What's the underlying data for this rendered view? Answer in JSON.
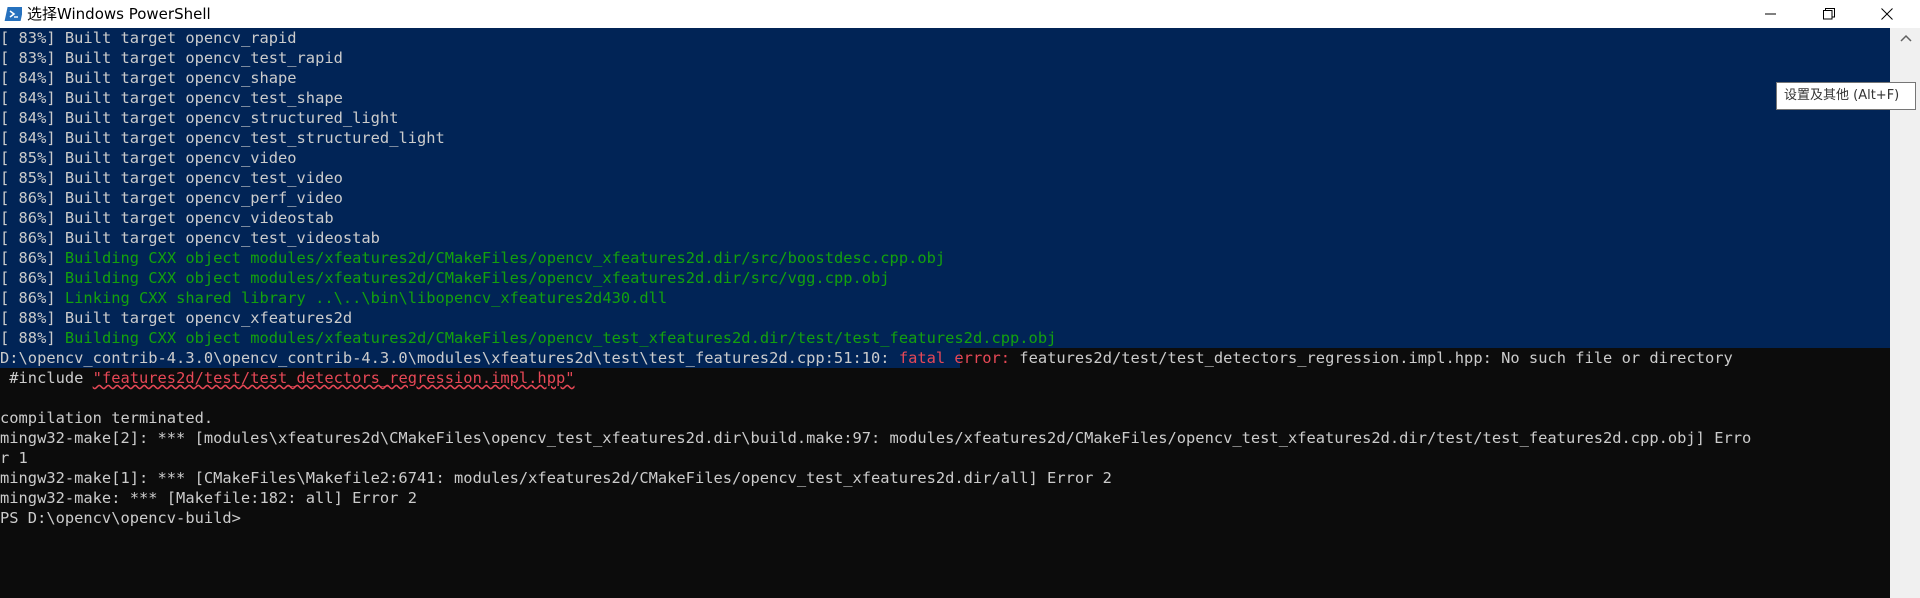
{
  "window": {
    "title": "选择Windows PowerShell",
    "tooltip": "设置及其他 (Alt+F)"
  },
  "terminal": {
    "build_lines": [
      {
        "pct": "[ 83%]",
        "msg": "Built target opencv_rapid",
        "color": "default"
      },
      {
        "pct": "[ 83%]",
        "msg": "Built target opencv_test_rapid",
        "color": "default"
      },
      {
        "pct": "[ 84%]",
        "msg": "Built target opencv_shape",
        "color": "default"
      },
      {
        "pct": "[ 84%]",
        "msg": "Built target opencv_test_shape",
        "color": "default"
      },
      {
        "pct": "[ 84%]",
        "msg": "Built target opencv_structured_light",
        "color": "default"
      },
      {
        "pct": "[ 84%]",
        "msg": "Built target opencv_test_structured_light",
        "color": "default"
      },
      {
        "pct": "[ 85%]",
        "msg": "Built target opencv_video",
        "color": "default"
      },
      {
        "pct": "[ 85%]",
        "msg": "Built target opencv_test_video",
        "color": "default"
      },
      {
        "pct": "[ 86%]",
        "msg": "Built target opencv_perf_video",
        "color": "default"
      },
      {
        "pct": "[ 86%]",
        "msg": "Built target opencv_videostab",
        "color": "default"
      },
      {
        "pct": "[ 86%]",
        "msg": "Built target opencv_test_videostab",
        "color": "default"
      },
      {
        "pct": "[ 86%]",
        "msg": "Building CXX object modules/xfeatures2d/CMakeFiles/opencv_xfeatures2d.dir/src/boostdesc.cpp.obj",
        "color": "green"
      },
      {
        "pct": "[ 86%]",
        "msg": "Building CXX object modules/xfeatures2d/CMakeFiles/opencv_xfeatures2d.dir/src/vgg.cpp.obj",
        "color": "green"
      },
      {
        "pct": "[ 86%]",
        "msg": "Linking CXX shared library ..\\..\\bin\\libopencv_xfeatures2d430.dll",
        "color": "green"
      },
      {
        "pct": "[ 88%]",
        "msg": "Built target opencv_xfeatures2d",
        "color": "default"
      },
      {
        "pct": "[ 88%]",
        "msg": "Building CXX object modules/xfeatures2d/CMakeFiles/opencv_test_xfeatures2d.dir/test/test_features2d.cpp.obj",
        "color": "green"
      }
    ],
    "error_path": "D:\\opencv_contrib-4.3.0\\opencv_contrib-4.3.0\\modules\\xfeatures2d\\test\\test_features2d.cpp:51:10:",
    "error_label": "fatal error:",
    "error_msg": "features2d/test/test_detectors_regression.impl.hpp: No such file or directory",
    "include_prefix": " #include ",
    "include_file": "\"features2d/test/test_detectors_regression.impl.hpp\"",
    "tail_lines": [
      "",
      "compilation terminated.",
      "mingw32-make[2]: *** [modules\\xfeatures2d\\CMakeFiles\\opencv_test_xfeatures2d.dir\\build.make:97: modules/xfeatures2d/CMakeFiles/opencv_test_xfeatures2d.dir/test/test_features2d.cpp.obj] Erro",
      "r 1",
      "mingw32-make[1]: *** [CMakeFiles\\Makefile2:6741: modules/xfeatures2d/CMakeFiles/opencv_test_xfeatures2d.dir/all] Error 2",
      "mingw32-make: *** [Makefile:182: all] Error 2",
      "PS D:\\opencv\\opencv-build>"
    ]
  }
}
